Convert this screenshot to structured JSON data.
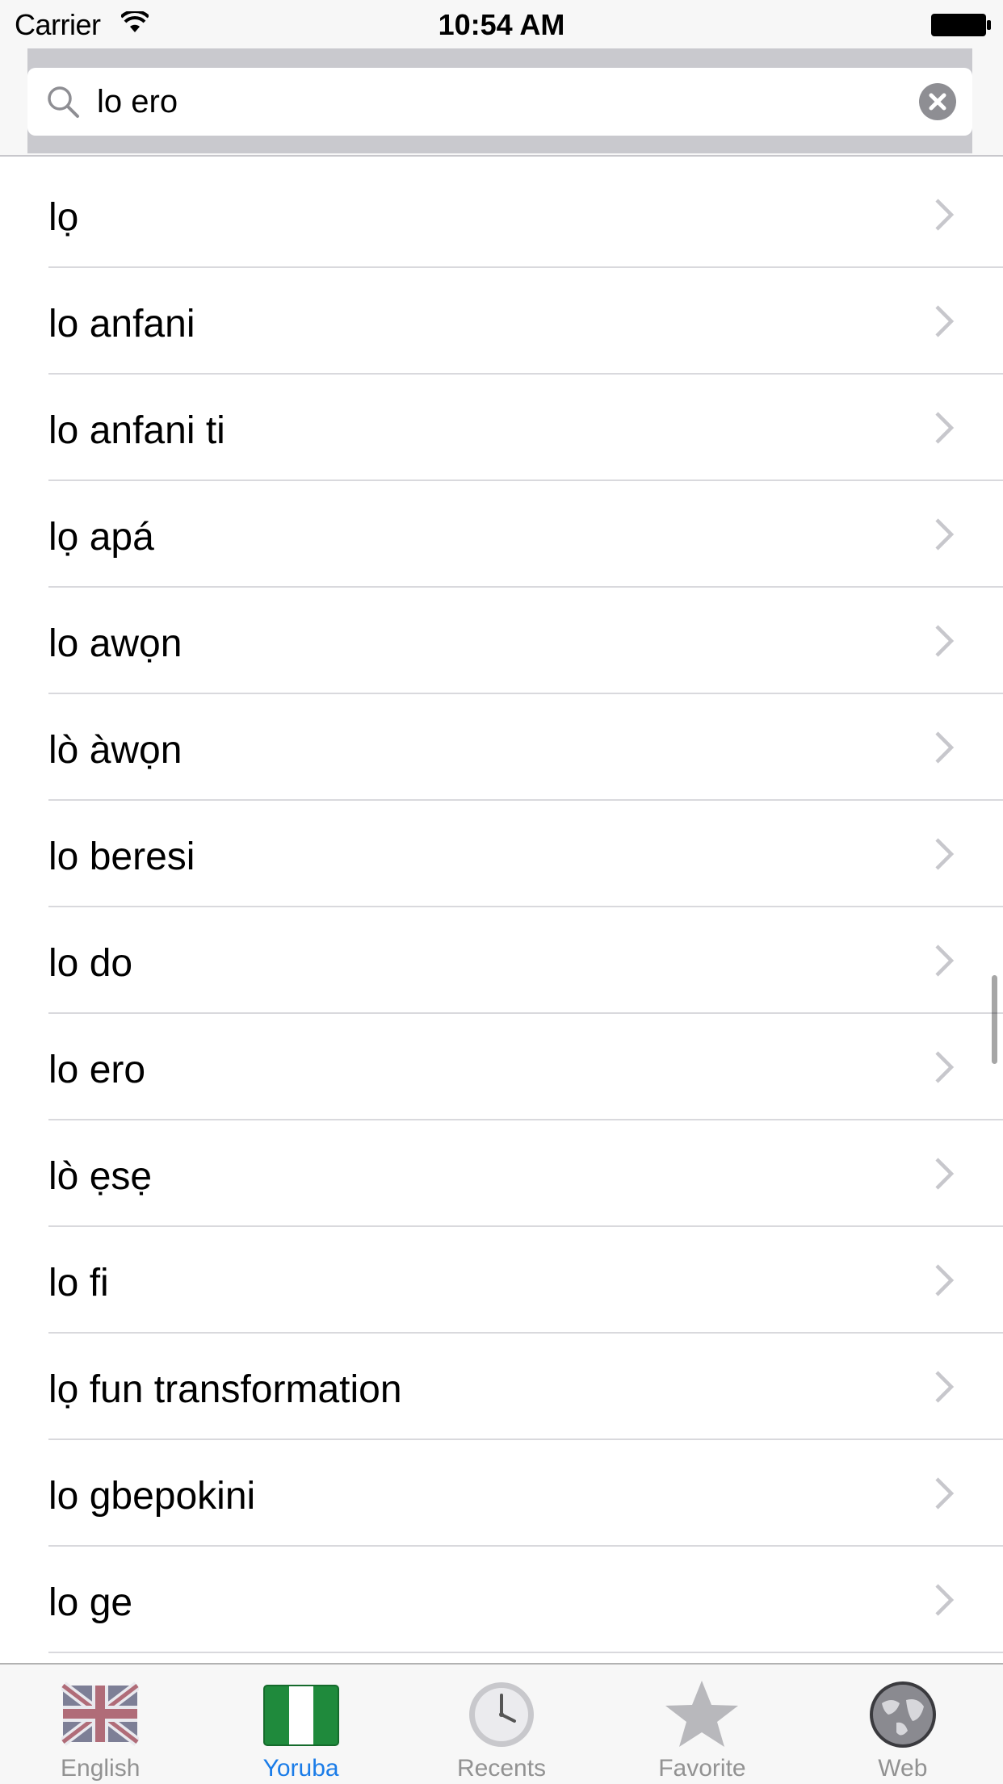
{
  "status_bar": {
    "carrier": "Carrier",
    "time": "10:54 AM"
  },
  "search": {
    "value": "lo ero"
  },
  "results": [
    "lọ",
    "lo anfani",
    "lo anfani ti",
    "lọ apá",
    "lo awọn",
    "lò àwọn",
    "lo beresi",
    "lo do",
    "lo ero",
    "lò ẹsẹ",
    "lo fi",
    "lọ fun transformation",
    "lo gbepokini",
    "lo ge"
  ],
  "tabs": [
    {
      "label": "English",
      "icon": "uk-flag-icon",
      "active": false
    },
    {
      "label": "Yoruba",
      "icon": "nigeria-flag-icon",
      "active": true
    },
    {
      "label": "Recents",
      "icon": "clock-icon",
      "active": false
    },
    {
      "label": "Favorite",
      "icon": "star-icon",
      "active": false
    },
    {
      "label": "Web",
      "icon": "globe-icon",
      "active": false
    }
  ],
  "colors": {
    "accent": "#1a7ce8",
    "tab_inactive": "#929292",
    "separator": "#d9d9dd"
  }
}
